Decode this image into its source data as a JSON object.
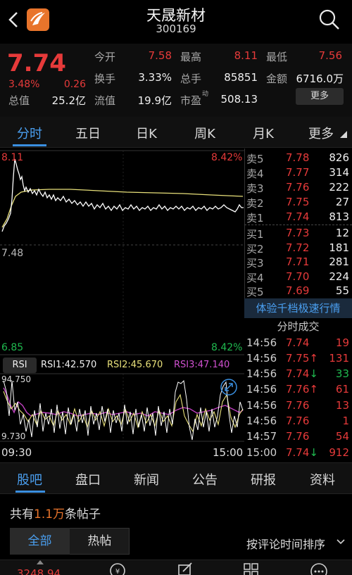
{
  "header": {
    "title": "天晟新材",
    "code": "300169"
  },
  "quote": {
    "price": "7.74",
    "pct": "3.48%",
    "change": "0.26",
    "open_label": "今开",
    "open": "7.58",
    "high_label": "最高",
    "high": "8.11",
    "low_label": "最低",
    "low": "7.56",
    "turnover_label": "换手",
    "turnover": "3.33%",
    "volume_label": "总手",
    "volume": "85851",
    "amount_label": "金额",
    "amount": "6716.0万",
    "mcap_label": "总值",
    "mcap": "25.2亿",
    "float_label": "流值",
    "float": "19.9亿",
    "pe_label": "市盈",
    "pe_sup": "动",
    "pe": "508.13",
    "more": "更多"
  },
  "tabs": [
    "分时",
    "五日",
    "日K",
    "周K",
    "月K",
    "更多"
  ],
  "chart": {
    "top_price": "8.11",
    "top_pct": "8.42%",
    "mid_price": "7.48",
    "bottom_price": "6.85",
    "bottom_pct": "8.42%",
    "rsi_tab": "RSI",
    "rsi1": "RSI1:42.570",
    "rsi2": "RSI2:45.670",
    "rsi3": "RSI3:47.140",
    "rsi_top": "94.750",
    "rsi_bottom": "9.730",
    "time_start": "09:30",
    "time_end": "15:00",
    "colors": {
      "price": "#ffffff",
      "avg": "#e8e07a",
      "rsi1": "#ffffff",
      "rsi2": "#e8e07a",
      "rsi3": "#c040c0"
    }
  },
  "book": {
    "asks": [
      {
        "label": "卖5",
        "price": "7.78",
        "vol": "826"
      },
      {
        "label": "卖4",
        "price": "7.77",
        "vol": "314"
      },
      {
        "label": "卖3",
        "price": "7.76",
        "vol": "222"
      },
      {
        "label": "卖2",
        "price": "7.75",
        "vol": "27"
      },
      {
        "label": "卖1",
        "price": "7.74",
        "vol": "813"
      }
    ],
    "bids": [
      {
        "label": "买1",
        "price": "7.73",
        "vol": "12"
      },
      {
        "label": "买2",
        "price": "7.72",
        "vol": "181"
      },
      {
        "label": "买3",
        "price": "7.71",
        "vol": "281"
      },
      {
        "label": "买4",
        "price": "7.70",
        "vol": "224"
      },
      {
        "label": "买5",
        "price": "7.69",
        "vol": "55"
      }
    ],
    "promo": "体验千档极速行情",
    "ticks_title": "分时成交",
    "ticks": [
      {
        "time": "14:56",
        "price": "7.74",
        "arrow": "",
        "vol": "19",
        "color": "red",
        "vcolor": "red"
      },
      {
        "time": "14:56",
        "price": "7.75",
        "arrow": "↑",
        "vol": "131",
        "color": "red",
        "vcolor": "red"
      },
      {
        "time": "14:56",
        "price": "7.74",
        "arrow": "↓",
        "vol": "33",
        "color": "red",
        "vcolor": "green"
      },
      {
        "time": "14:56",
        "price": "7.76",
        "arrow": "↑",
        "vol": "61",
        "color": "red",
        "vcolor": "red"
      },
      {
        "time": "14:56",
        "price": "7.76",
        "arrow": "",
        "vol": "13",
        "color": "red",
        "vcolor": "red"
      },
      {
        "time": "14:56",
        "price": "7.76",
        "arrow": "",
        "vol": "1",
        "color": "red",
        "vcolor": "red"
      },
      {
        "time": "14:57",
        "price": "7.76",
        "arrow": "",
        "vol": "54",
        "color": "red",
        "vcolor": "red"
      },
      {
        "time": "15:00",
        "price": "7.74",
        "arrow": "↓",
        "vol": "912",
        "color": "red",
        "vcolor": "red"
      }
    ]
  },
  "bottom_tabs": [
    "股吧",
    "盘口",
    "新闻",
    "公告",
    "研报",
    "资料"
  ],
  "forum": {
    "count_pre": "共有",
    "count_num": "1.1万",
    "count_post": "条帖子",
    "seg_all": "全部",
    "seg_hot": "热帖",
    "sort": "按评论时间排序"
  },
  "bottom_bar": {
    "index": "3248.94"
  }
}
